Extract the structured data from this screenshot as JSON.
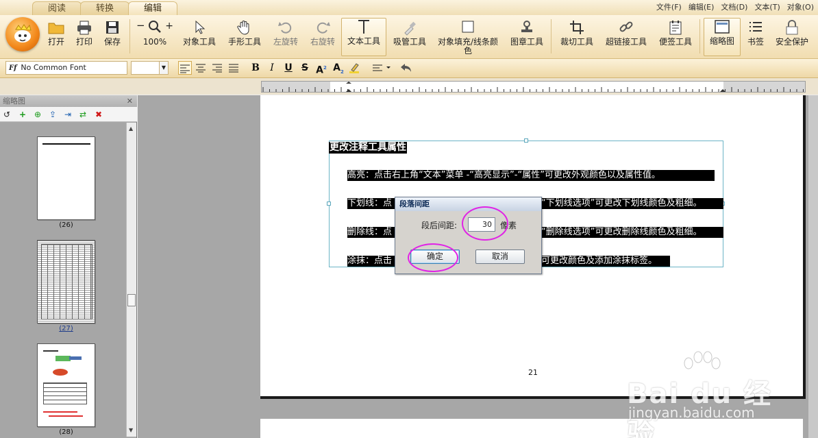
{
  "tabs": [
    "阅读",
    "转换",
    "编辑"
  ],
  "menu": [
    "文件(F)",
    "编辑(E)",
    "文档(D)",
    "文本(T)",
    "对象(O)"
  ],
  "ribbon": {
    "open": "打开",
    "print": "打印",
    "save": "保存",
    "zoom": "100%",
    "zoom_minus": "−",
    "zoom_plus": "+",
    "object_tool": "对象工具",
    "hand_tool": "手形工具",
    "rotate_left": "左旋转",
    "rotate_right": "右旋转",
    "text_tool": "文本工具",
    "eyedropper": "吸管工具",
    "fill_line_color_1": "对象填充/线条颜",
    "fill_line_color_2": "色",
    "stamp": "图章工具",
    "crop": "裁切工具",
    "hyperlink": "超链接工具",
    "sticky": "便签工具",
    "thumbnail": "缩略图",
    "bookmark": "书签",
    "security": "安全保护"
  },
  "format": {
    "font": "No Common Font",
    "font_icon": "Ff",
    "bold": "B",
    "italic": "I",
    "underline": "U",
    "strike": "S",
    "superscript": "A",
    "subscript": "A"
  },
  "leftpanel": {
    "title": "缩略图",
    "close": "✕",
    "thumbnails": [
      "(26)",
      "(27)",
      "(28)"
    ]
  },
  "document": {
    "heading": "更改注释工具属性",
    "lines": [
      "高亮：点击右上角“文本”菜单 -“高亮显示”-“属性”可更改外观颜色以及属性值。",
      "下划线：点",
      "“下划线选项”可更改下划线颜色及粗细。",
      "删除线：点",
      "“删除线选项”可更改删除线颜色及粗细。",
      "涂抹：点击",
      "可更改颜色及添加涂抹标签。"
    ],
    "page_number": "21"
  },
  "dialog": {
    "title": "段落间距",
    "label": "段后间距:",
    "value": "30",
    "unit": "像素",
    "ok": "确定",
    "cancel": "取消"
  },
  "watermark": {
    "text": "Bai du 经验",
    "url": "jingyan.baidu.com"
  },
  "colors": {
    "ribbon": "#f1ddb0",
    "highlight_circle": "#e022e6",
    "selection_box": "#6bb4c6"
  }
}
